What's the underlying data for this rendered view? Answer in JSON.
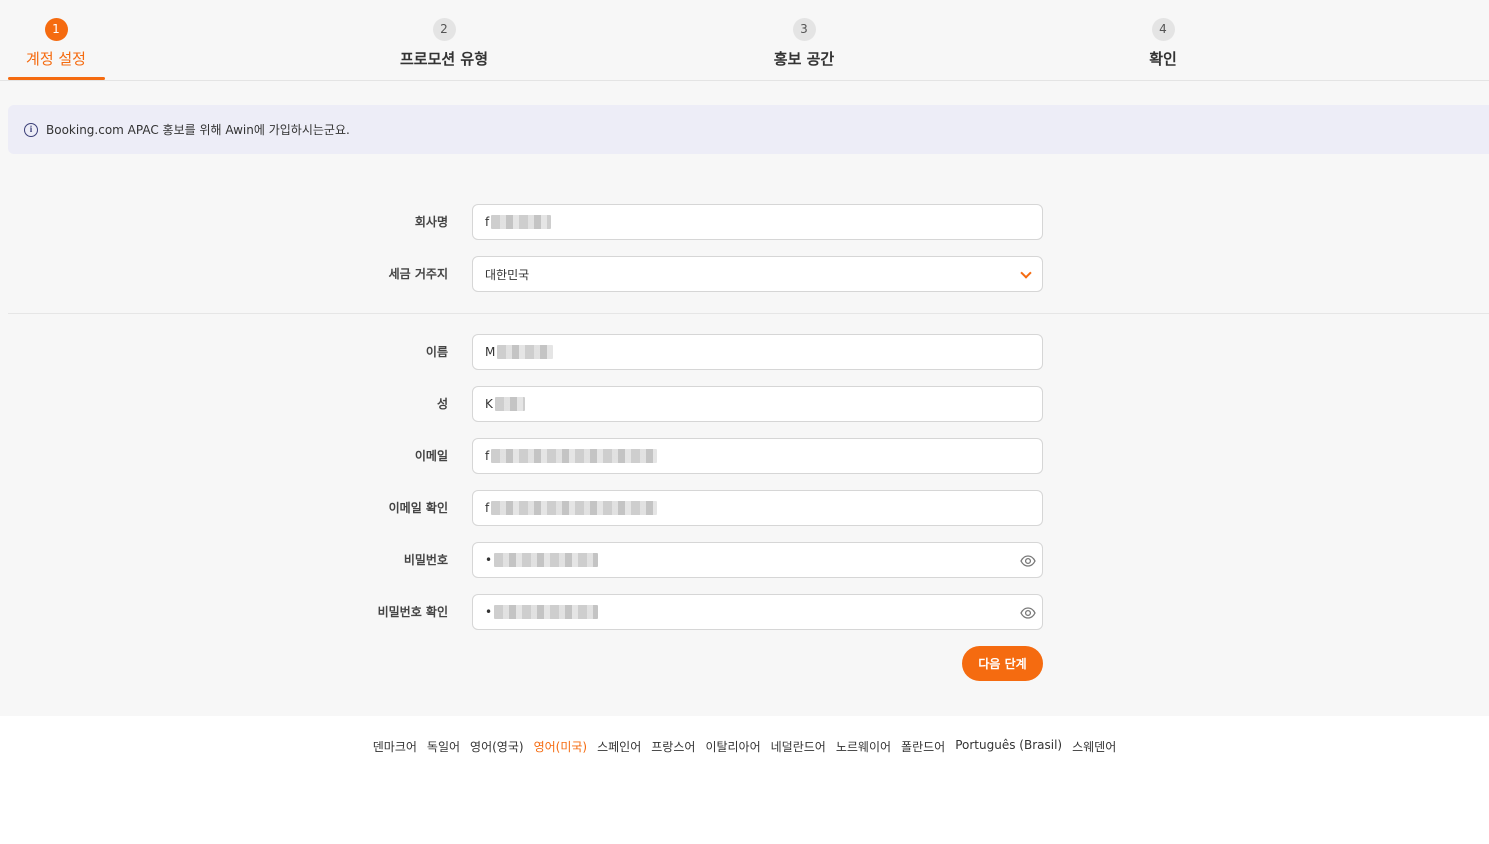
{
  "stepper": {
    "steps": [
      {
        "number": "1",
        "label": "계정 설정"
      },
      {
        "number": "2",
        "label": "프로모션 유형"
      },
      {
        "number": "3",
        "label": "홍보 공간"
      },
      {
        "number": "4",
        "label": "확인"
      }
    ],
    "active_step": 1
  },
  "info_banner": {
    "icon": "info-icon",
    "text": "Booking.com APAC 홍보를 위해 Awin에 가입하시는군요."
  },
  "form": {
    "company_name": {
      "label": "회사명",
      "value": "f"
    },
    "tax_residence": {
      "label": "세금 거주지",
      "value": "대한민국"
    },
    "first_name": {
      "label": "이름",
      "value": "M"
    },
    "last_name": {
      "label": "성",
      "value": "K"
    },
    "email": {
      "label": "이메일",
      "value": "f"
    },
    "email_confirm": {
      "label": "이메일 확인",
      "value": "f"
    },
    "password": {
      "label": "비밀번호",
      "value": "•"
    },
    "password_confirm": {
      "label": "비밀번호 확인",
      "value": "•"
    },
    "next_button": "다음 단계"
  },
  "footer": {
    "languages": [
      "덴마크어",
      "독일어",
      "영어(영국)",
      "영어(미국)",
      "스페인어",
      "프랑스어",
      "이탈리아어",
      "네덜란드어",
      "노르웨이어",
      "폴란드어",
      "Português (Brasil)",
      "스웨덴어"
    ],
    "selected_language": "영어(미국)"
  },
  "colors": {
    "accent": "#f56b10",
    "banner_bg": "#ededf7",
    "page_bg": "#f7f7f7"
  }
}
